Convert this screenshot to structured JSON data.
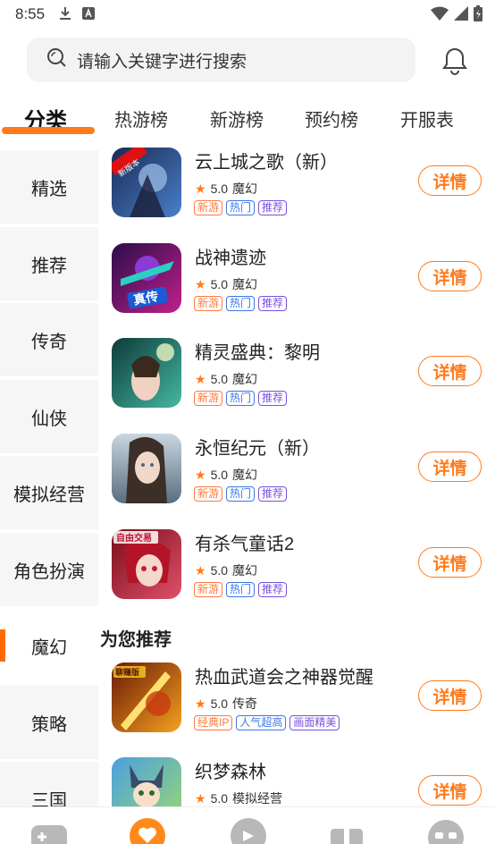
{
  "status_bar": {
    "time": "8:55",
    "icons": [
      "download-icon",
      "a-badge-icon",
      "wifi-icon",
      "signal-icon",
      "battery-icon"
    ]
  },
  "search": {
    "placeholder": "请输入关键字进行搜索"
  },
  "tabs": [
    {
      "label": "分类",
      "active": true
    },
    {
      "label": "热游榜"
    },
    {
      "label": "新游榜"
    },
    {
      "label": "预约榜"
    },
    {
      "label": "开服表"
    }
  ],
  "sidebar": [
    {
      "label": "精选"
    },
    {
      "label": "推荐"
    },
    {
      "label": "传奇"
    },
    {
      "label": "仙侠"
    },
    {
      "label": "模拟经营"
    },
    {
      "label": "角色扮演"
    },
    {
      "label": "魔幻",
      "active": true
    },
    {
      "label": "策略"
    },
    {
      "label": "三国"
    }
  ],
  "games": [
    {
      "name": "云上城之歌（新）",
      "rating": "5.0",
      "genre": "魔幻",
      "tags": [
        "新游",
        "热门",
        "推荐"
      ],
      "detail": "详情"
    },
    {
      "name": "战神遗迹",
      "rating": "5.0",
      "genre": "魔幻",
      "tags": [
        "新游",
        "热门",
        "推荐"
      ],
      "detail": "详情"
    },
    {
      "name": "精灵盛典：黎明",
      "rating": "5.0",
      "genre": "魔幻",
      "tags": [
        "新游",
        "热门",
        "推荐"
      ],
      "detail": "详情"
    },
    {
      "name": "永恒纪元（新）",
      "rating": "5.0",
      "genre": "魔幻",
      "tags": [
        "新游",
        "热门",
        "推荐"
      ],
      "detail": "详情"
    },
    {
      "name": "有杀气童话2",
      "rating": "5.0",
      "genre": "魔幻",
      "tags": [
        "新游",
        "热门",
        "推荐"
      ],
      "detail": "详情"
    }
  ],
  "recommend_title": "为您推荐",
  "recommended": [
    {
      "name": "热血武道会之神器觉醒",
      "rating": "5.0",
      "genre": "传奇",
      "tags": [
        "经典IP",
        "人气超高",
        "画面精美"
      ],
      "detail": "详情"
    },
    {
      "name": "织梦森林",
      "rating": "5.0",
      "genre": "模拟经营",
      "tags": [],
      "detail": "详情"
    }
  ],
  "thumb_text": {
    "g0": "新版本",
    "g1": "真传",
    "g4": "自由交易",
    "r0": "聊赚版"
  },
  "bottom_nav": [
    "game-controller-icon",
    "heart-chat-icon",
    "discover-icon",
    "gift-icon",
    "profile-icon"
  ],
  "colors": {
    "accent": "#ff7a1a",
    "tag_orange": "#ff7a3d",
    "tag_blue": "#3a78e8",
    "tag_purple": "#7b4fe0"
  }
}
